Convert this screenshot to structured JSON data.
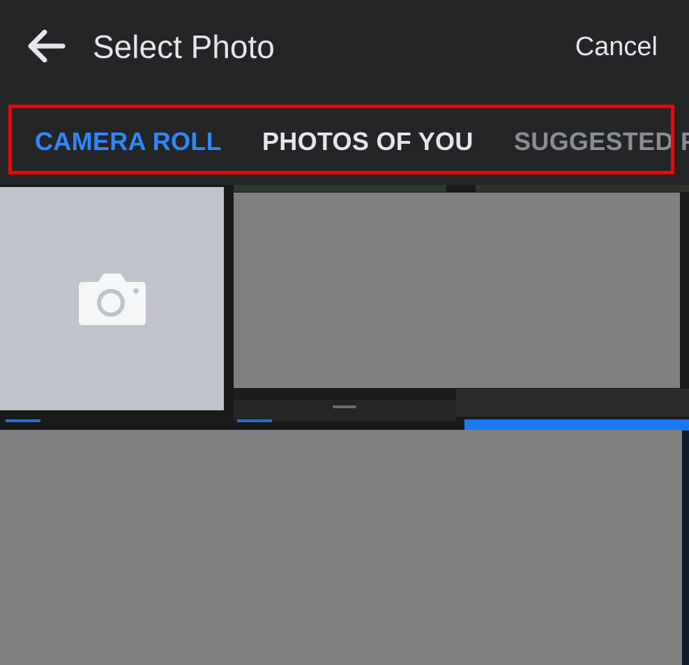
{
  "header": {
    "back_icon": "arrow-left-icon",
    "title": "Select Photo",
    "cancel_label": "Cancel"
  },
  "tabs": [
    {
      "label": "CAMERA ROLL",
      "active": true,
      "color": "#2d88ff"
    },
    {
      "label": "PHOTOS OF YOU",
      "active": false,
      "color": "#e4e6eb"
    },
    {
      "label": "SUGGESTED P",
      "active": false,
      "color": "#8a8d91"
    }
  ],
  "grid": {
    "camera_tile_icon": "camera-icon"
  },
  "colors": {
    "background": "#242526",
    "accent": "#2d88ff",
    "highlight_box": "#ff0000",
    "camera_tile": "#bec3cc",
    "placeholder_thumb": "#808080"
  }
}
